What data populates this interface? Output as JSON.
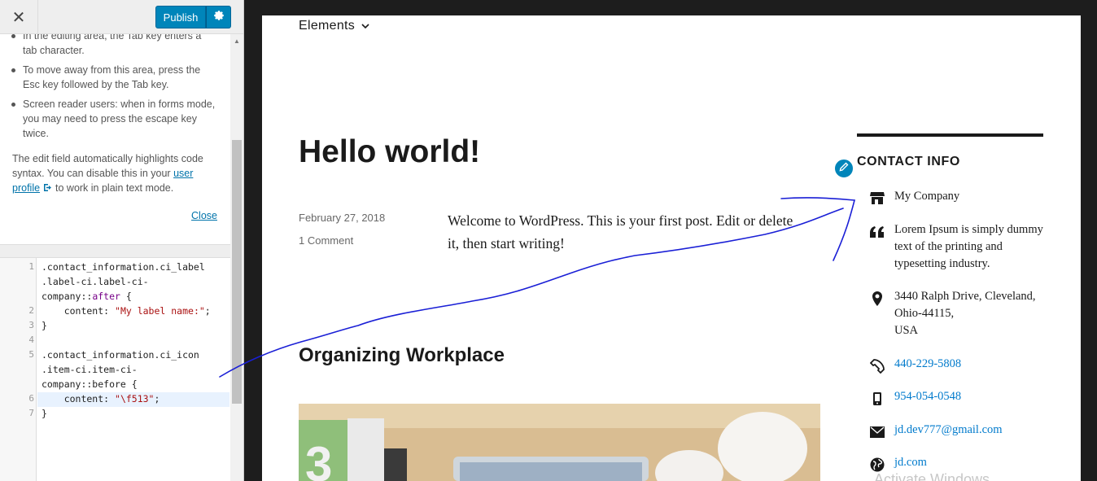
{
  "toolbar": {
    "close_label": "✕",
    "publish_label": "Publish"
  },
  "help": {
    "bullet_1": "In the editing area, the Tab key enters a tab character.",
    "bullet_2": "To move away from this area, press the Esc key followed by the Tab key.",
    "bullet_3": "Screen reader users: when in forms mode, you may need to press the escape key twice.",
    "para_before": "The edit field automatically highlights code syntax. You can disable this in your",
    "link_text": "user profile",
    "para_after": "to work in plain text mode.",
    "close_label": "Close"
  },
  "code": {
    "line_numbers": [
      "1",
      "2",
      "3",
      "4",
      "5",
      "6",
      "7"
    ],
    "l1a": ".contact_information.ci_label",
    "l1b": ".label-ci.label-ci-",
    "l1c_pre": "company::",
    "l1c_kw": "after",
    "l1c_post": " {",
    "l2_pre": "    content: ",
    "l2_str": "\"My label name:\"",
    "l2_post": ";",
    "l3": "}",
    "l5a": ".contact_information.ci_icon",
    "l5b": ".item-ci.item-ci-",
    "l5c": "company::before {",
    "l6_pre": "    content: ",
    "l6_str": "\"\\f513\"",
    "l6_post": ";",
    "l7": "}"
  },
  "preview": {
    "nav_item": "Elements",
    "post_title": "Hello world!",
    "post_date": "February 27, 2018",
    "post_comments": "1 Comment",
    "post_body": "Welcome to WordPress. This is your first post. Edit or delete it, then start writing!",
    "post2_title": "Organizing Workplace",
    "widget_title": "CONTACT INFO",
    "company": "My Company",
    "description": "Lorem Ipsum is simply dummy text of the printing and typesetting industry.",
    "address_1": "3440 Ralph Drive, Cleveland, Ohio-44115,",
    "address_2": "USA",
    "phone": "440-229-5808",
    "mobile": "954-054-0548",
    "email": "jd.dev777@gmail.com",
    "website": "jd.com",
    "watermark": "Activate Windows"
  },
  "colors": {
    "accent": "#0085ba",
    "link": "#007acc",
    "annotation": "#1a1fd6"
  }
}
